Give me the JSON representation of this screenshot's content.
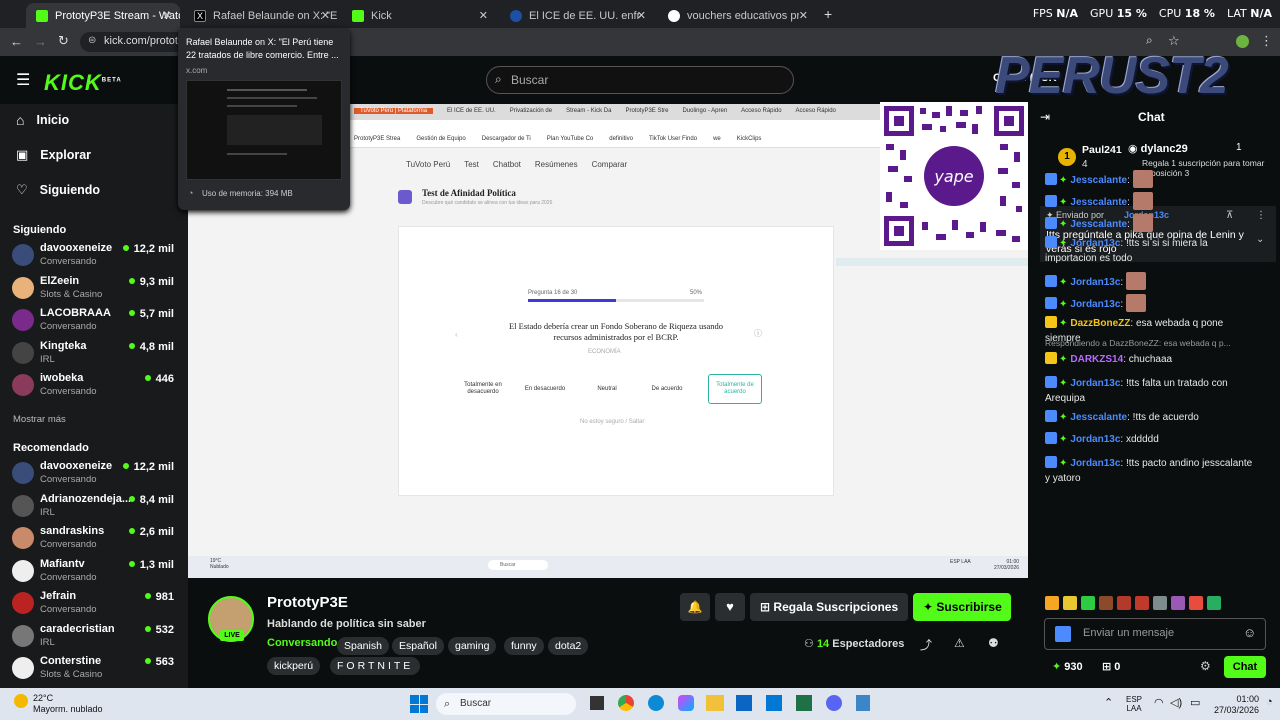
{
  "browser": {
    "tabs": [
      {
        "label": "PrototyP3E Stream - Watch Live",
        "active": true
      },
      {
        "label": "Rafael Belaunde on X: \"El Perú",
        "active": false
      },
      {
        "label": "Kick",
        "active": false
      },
      {
        "label": "El ICE de EE. UU. enfrentará juic",
        "active": false
      },
      {
        "label": "vouchers educativos propuesta",
        "active": false
      }
    ],
    "new_tab": "+",
    "url": "kick.com/prototyp",
    "tooltip": {
      "title": "Rafael Belaunde on X: \"El Perú tiene 22 tratados de libre comercio. Entre ...",
      "domain": "x.com",
      "memory": "Uso de memoria: 394 MB"
    }
  },
  "perf": {
    "fps_label": "FPS",
    "fps": "N/A",
    "gpu_label": "GPU",
    "gpu": "15 %",
    "cpu_label": "CPU",
    "cpu": "18 %",
    "lat_label": "LAT",
    "lat": "N/A"
  },
  "kick": {
    "logo": "KICK",
    "logo_sup": "BETA",
    "search_placeholder": "Buscar",
    "nav": [
      {
        "label": "Inicio",
        "icon": "home-icon"
      },
      {
        "label": "Explorar",
        "icon": "compass-icon"
      },
      {
        "label": "Siguiendo",
        "icon": "heart-icon"
      }
    ],
    "following_title": "Siguiendo",
    "following": [
      {
        "name": "davooxeneize",
        "category": "Conversando",
        "viewers": "12,2 mil",
        "color": "#3a4d7a"
      },
      {
        "name": "ElZeein",
        "category": "Slots & Casino",
        "viewers": "9,3 mil",
        "color": "#e8b27a"
      },
      {
        "name": "LACOBRAAA",
        "category": "Conversando",
        "viewers": "5,7 mil",
        "color": "#7a2a8a"
      },
      {
        "name": "Kingteka",
        "category": "IRL",
        "viewers": "4,8 mil",
        "color": "#444"
      },
      {
        "name": "iwobeka",
        "category": "Conversando",
        "viewers": "446",
        "color": "#8a3a5a"
      }
    ],
    "show_more": "Mostrar más",
    "recommended_title": "Recomendado",
    "recommended": [
      {
        "name": "davooxeneize",
        "category": "Conversando",
        "viewers": "12,2 mil",
        "color": "#3a4d7a"
      },
      {
        "name": "Adrianozendeja...",
        "category": "IRL",
        "viewers": "8,4 mil",
        "color": "#555"
      },
      {
        "name": "sandraskins",
        "category": "Conversando",
        "viewers": "2,6 mil",
        "color": "#c98a6a"
      },
      {
        "name": "Mafiantv",
        "category": "Conversando",
        "viewers": "1,3 mil",
        "color": "#eee"
      },
      {
        "name": "Jefrain",
        "category": "Conversando",
        "viewers": "981",
        "color": "#b22"
      },
      {
        "name": "caradecristian",
        "category": "IRL",
        "viewers": "532",
        "color": "#777"
      },
      {
        "name": "Conterstine",
        "category": "Slots & Casino",
        "viewers": "563",
        "color": "#eee"
      }
    ],
    "accent": "#53fc18"
  },
  "overlay": {
    "brand": "PERUST2",
    "kick_label": "O... en KICK"
  },
  "video": {
    "bookmarks": [
      "TuVoto Perú | Plataforma",
      "El ICE de EE. UU.",
      "Privatización de",
      "Stream - Kick Da",
      "PrototyP3E Stre",
      "Duolingo - Apren",
      "Acceso Rápido",
      "Acceso Rápido"
    ],
    "bookmarks2": [
      "PrototyP3E Strea",
      "Gestión de Equipo",
      "Descargador de Ti",
      "Plan YouTube Co",
      "definitivo",
      "TikTok User Findo",
      "we",
      "KickClips"
    ],
    "site_nav": [
      "TuVoto Perú",
      "Test",
      "Chatbot",
      "Resúmenes",
      "Comparar"
    ],
    "test_title": "Test de Afinidad Política",
    "test_subtitle": "Descubre qué candidato se alinea con tus ideas para 2026",
    "question_progress": "Pregunta 16 de 30",
    "percent": "50%",
    "progress": 0.5,
    "question": "El Estado debería crear un Fondo Soberano de Riqueza usando recursos administrados por el BCRP.",
    "category": "ECONOMÍA",
    "options": [
      "Totalmente en desacuerdo",
      "En desacuerdo",
      "Neutral",
      "De acuerdo",
      "Totalmente de acuerdo"
    ],
    "skip": "No estoy seguro / Saltar",
    "inner_taskbar": {
      "weather_temp": "19°C",
      "weather_desc": "Nublado",
      "search": "Buscar",
      "lang": "ESP LAA",
      "time": "01:00",
      "date": "27/03/2026"
    }
  },
  "chat": {
    "title": "Chat",
    "top_gifters": [
      {
        "name": "Paul241",
        "count": "4",
        "rank": "1"
      },
      {
        "name": "dylanc29",
        "count": "1"
      }
    ],
    "gift_prompt": "Regala 1 suscripción para tomar la posición 3",
    "pinned_by_label": "Enviado por",
    "pinned_by": "Jordan13c",
    "pinned_text": "!tts pregúntale a pika que opina de Lenin y verás si es rojo",
    "messages": [
      {
        "user": "Jesscalante",
        "text": "",
        "color": "#4b8bff"
      },
      {
        "user": "Jesscalante",
        "text": "",
        "color": "#4b8bff"
      },
      {
        "user": "Jesscalante",
        "text": "",
        "color": "#4b8bff"
      },
      {
        "user": "Jordan13c",
        "text": "!tts si si si miera la importacion es todo",
        "color": "#4b8bff"
      },
      {
        "user": "Jordan13c",
        "text": "",
        "color": "#4b8bff"
      },
      {
        "user": "Jordan13c",
        "text": "",
        "color": "#4b8bff"
      },
      {
        "user": "DazzBoneZZ",
        "text": "esa webada q pone siempre",
        "color": "#f5c518"
      },
      {
        "user": "DARKZS14",
        "text": "chuchaaa",
        "color": "#b76bff",
        "reply": "Respondiendo a DazzBoneZZ: esa webada q p..."
      },
      {
        "user": "Jordan13c",
        "text": "!tts falta un tratado con Arequipa",
        "color": "#4b8bff"
      },
      {
        "user": "Jesscalante",
        "text": "!tts de acuerdo",
        "color": "#4b8bff"
      },
      {
        "user": "Jordan13c",
        "text": "xddddd",
        "color": "#4b8bff"
      },
      {
        "user": "Jordan13c",
        "text": "!tts pacto andino jesscalante y yatoro",
        "color": "#4b8bff"
      }
    ],
    "input_placeholder": "Enviar un mensaje",
    "points": "930",
    "gifts": "0",
    "send_label": "Chat"
  },
  "stream": {
    "channel": "PrototyP3E",
    "live_label": "LIVE",
    "title": "Hablando de política sin saber",
    "category": "Conversando",
    "tags": [
      "Spanish",
      "Español",
      "gaming",
      "funny",
      "dota2",
      "kickperú",
      "FORTNITE"
    ],
    "gift_subs": "Regala Suscripciones",
    "subscribe": "Suscribirse",
    "viewers_count": "14",
    "viewers_label": "Espectadores"
  },
  "taskbar": {
    "temp": "22°C",
    "weather": "Mayorm. nublado",
    "search": "Buscar",
    "lang1": "ESP",
    "lang2": "LAA",
    "time": "01:00",
    "date": "27/03/2026"
  }
}
